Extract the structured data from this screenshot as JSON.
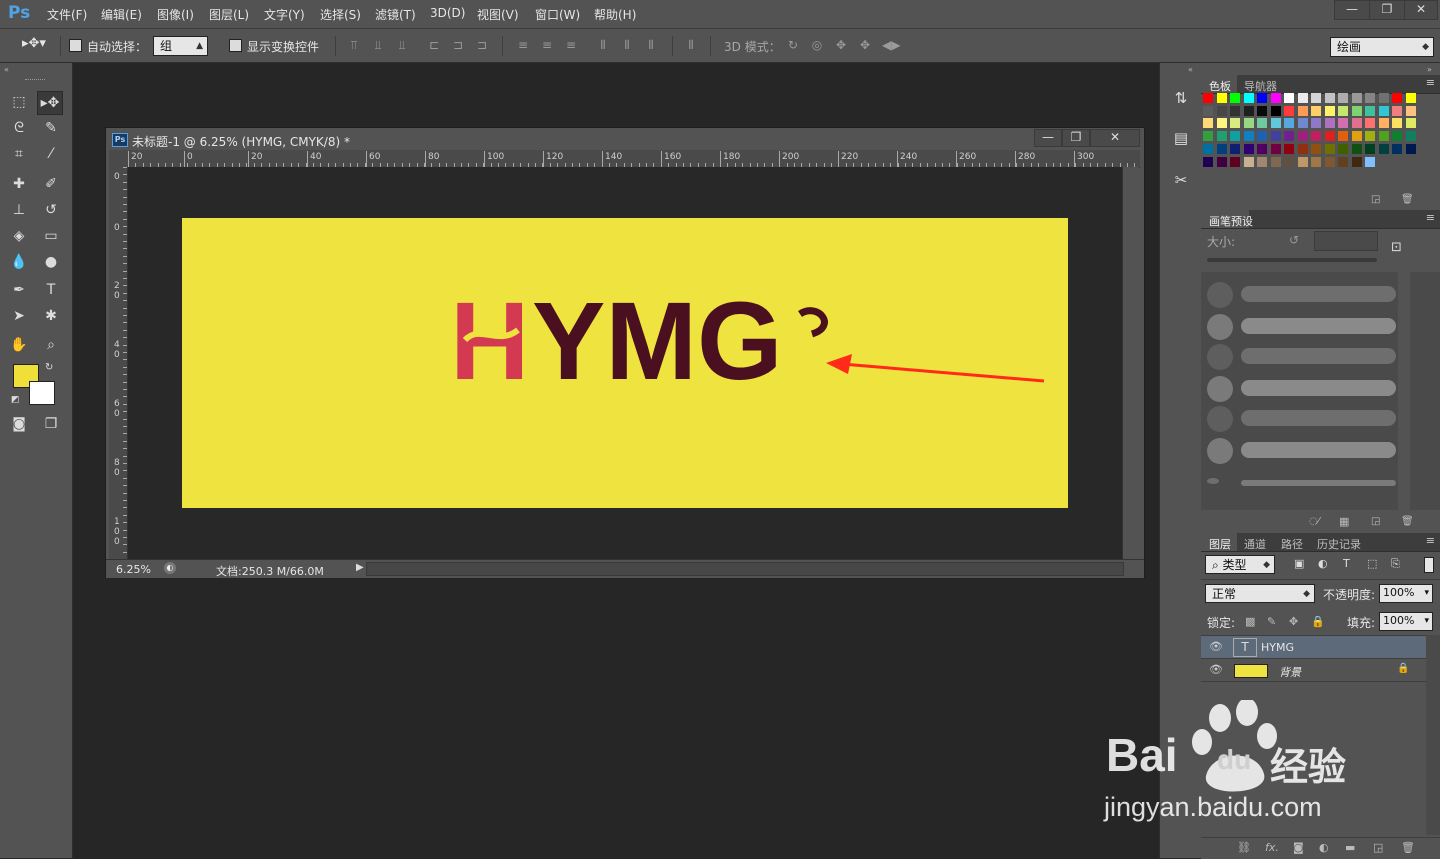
{
  "app": {
    "logo": "Ps"
  },
  "menu": [
    "文件(F)",
    "编辑(E)",
    "图像(I)",
    "图层(L)",
    "文字(Y)",
    "选择(S)",
    "滤镜(T)",
    "3D(D)",
    "视图(V)",
    "窗口(W)",
    "帮助(H)"
  ],
  "window_controls": {
    "minimize": "—",
    "restore": "❐",
    "close": "✕"
  },
  "options": {
    "auto_select_label": "自动选择：",
    "auto_select_value": "组",
    "show_transform_label": "显示变换控件",
    "mode_3d_label": "3D 模式：",
    "workspace": "绘画"
  },
  "document": {
    "icon": "Ps",
    "title": "未标题-1 @ 6.25% (HYMG, CMYK/8) *",
    "zoom": "6.25%",
    "doc_info": "文档:250.3 M/66.0M",
    "artwork_text": {
      "h": "H",
      "rest": "YMG"
    },
    "artboard_color": "#efe33f",
    "h_color": "#d33a52",
    "text_color": "#4a1020",
    "arrow_color": "#ff2a1a"
  },
  "rulers": {
    "top": [
      "20",
      "0",
      "20",
      "40",
      "60",
      "80",
      "100",
      "120",
      "140",
      "160",
      "180",
      "200",
      "220",
      "240",
      "260",
      "280",
      "300"
    ],
    "left": [
      "0",
      "0",
      "2\n0",
      "4\n0",
      "6\n0",
      "8\n0",
      "1\n0\n0"
    ]
  },
  "panels": {
    "color_tabs": [
      "色板",
      "导航器"
    ],
    "brush_preset_tab": "画笔预设",
    "brush_size_label": "大小:",
    "layers_tabs": [
      "图层",
      "通道",
      "路径",
      "历史记录"
    ],
    "layer_filter": "类型",
    "blend_mode": "正常",
    "opacity_label": "不透明度:",
    "opacity_value": "100%",
    "lock_label": "锁定:",
    "fill_label": "填充:",
    "fill_value": "100%",
    "layers": [
      {
        "name": "HYMG",
        "kind": "text",
        "thumb": "T"
      },
      {
        "name": "背景",
        "kind": "background",
        "thumb_color": "#efe33f"
      }
    ],
    "bottom_icons": [
      "link-icon",
      "fx-icon",
      "mask-icon",
      "adjustment-icon",
      "folder-icon",
      "new-layer-icon",
      "trash-icon"
    ],
    "fx_label": "fx."
  },
  "watermark": {
    "brand": "Bai",
    "brand2": "du",
    "cn": "经验",
    "url": "jingyan.baidu.com"
  },
  "colors": {
    "fg": "#f0df38",
    "bg": "#ffffff"
  }
}
